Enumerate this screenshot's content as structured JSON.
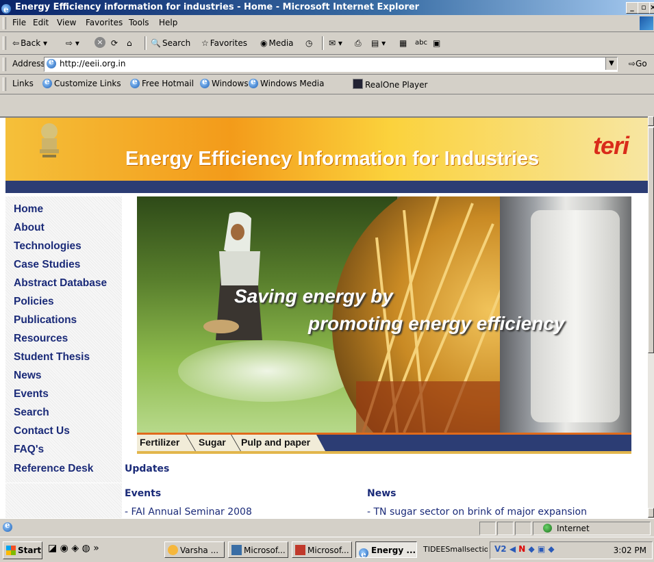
{
  "window": {
    "title": "Energy Efficiency information for industries - Home - Microsoft Internet Explorer"
  },
  "menu": [
    "File",
    "Edit",
    "View",
    "Favorites",
    "Tools",
    "Help"
  ],
  "toolbar": {
    "back": "Back",
    "search": "Search",
    "favorites": "Favorites",
    "media": "Media"
  },
  "address": {
    "label": "Address",
    "url": "http://eeii.org.in",
    "go": "Go"
  },
  "links": {
    "label": "Links",
    "items": [
      "Customize Links",
      "Free Hotmail",
      "Windows",
      "Windows Media",
      "RealOne Player"
    ]
  },
  "page": {
    "banner_title": "Energy Efficiency Information for Industries",
    "logo": "teri",
    "nav": [
      "Home",
      "About",
      "Technologies",
      "Case Studies",
      "Abstract Database",
      "Policies",
      "Publications",
      "Resources",
      "Student Thesis",
      "News",
      "Events",
      "Search",
      "Contact Us",
      "FAQ's",
      "Reference Desk"
    ],
    "slogan_line1": "Saving energy by",
    "slogan_line2": "promoting energy efficiency",
    "tabs": [
      "Fertilizer",
      "Sugar",
      "Pulp and paper"
    ],
    "updates_heading": "Updates",
    "events_heading": "Events",
    "news_heading": "News",
    "events_item": "- FAI Annual Seminar 2008",
    "news_item": "- TN sugar sector on brink of major expansion"
  },
  "status": {
    "zone": "Internet"
  },
  "taskbar": {
    "start": "Start",
    "tasks": [
      "Varsha ...",
      "Microsof...",
      "Microsof...",
      "Energy ...",
      "TIDEESmallsection"
    ],
    "clock": "3:02 PM"
  },
  "colors": {
    "nav_text": "#1a2a78",
    "banner_orange": "#f39b1a",
    "banner_blue": "#2c3d74",
    "teri_red": "#d92c1a",
    "title_bar": "#0a246a"
  }
}
